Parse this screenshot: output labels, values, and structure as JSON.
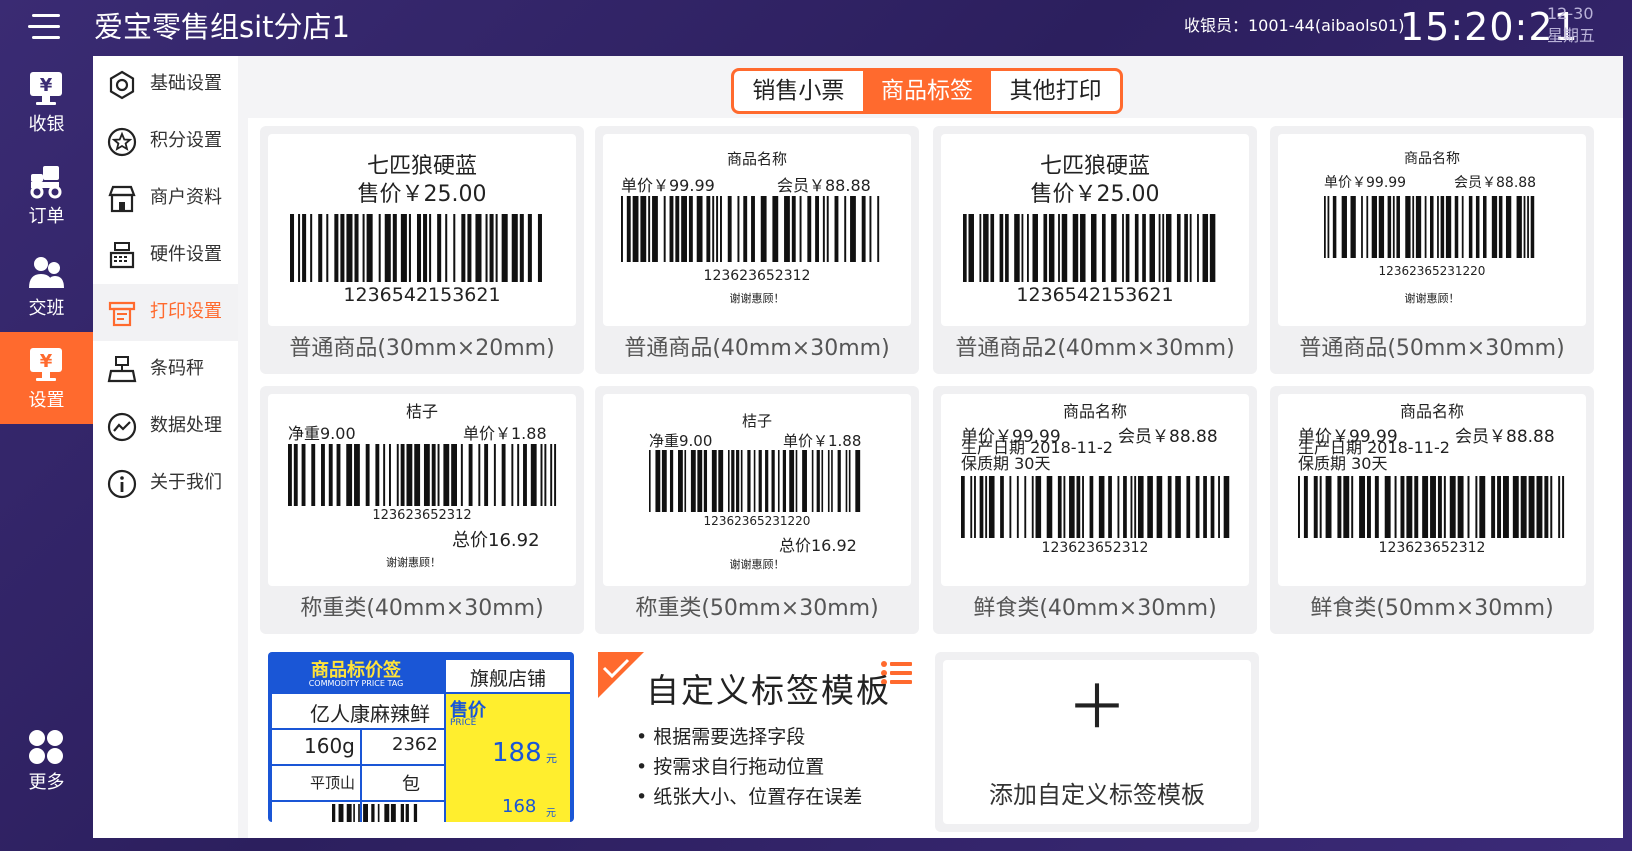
{
  "header": {
    "store_name": "爱宝零售组sit分店1",
    "cashier": "收银员：1001-44(aibaols01)",
    "time": "15:20:21",
    "date": "12-30",
    "weekday": "星期五"
  },
  "leftnav": {
    "items": [
      {
        "label": "收银",
        "icon": "cashier-icon"
      },
      {
        "label": "订单",
        "icon": "order-icon"
      },
      {
        "label": "交班",
        "icon": "shift-icon"
      },
      {
        "label": "设置",
        "icon": "settings-icon",
        "active": true
      },
      {
        "label": "更多",
        "icon": "more-icon"
      }
    ]
  },
  "submenu": {
    "items": [
      {
        "label": "基础设置"
      },
      {
        "label": "积分设置"
      },
      {
        "label": "商户资料"
      },
      {
        "label": "硬件设置"
      },
      {
        "label": "打印设置",
        "active": true
      },
      {
        "label": "条码秤"
      },
      {
        "label": "数据处理"
      },
      {
        "label": "关于我们"
      }
    ]
  },
  "tabs": [
    {
      "label": "销售小票"
    },
    {
      "label": "商品标签",
      "active": true
    },
    {
      "label": "其他打印"
    }
  ],
  "templates": {
    "t1": {
      "name": "七匹狼硬蓝",
      "price": "售价￥25.00",
      "code": "1236542153621",
      "caption": "普通商品(30mm×20mm)"
    },
    "t2": {
      "name": "商品名称",
      "unit": "单价￥99.99",
      "member": "会员￥88.88",
      "code": "123623652312",
      "thanks": "谢谢惠顾！",
      "caption": "普通商品(40mm×30mm)"
    },
    "t3": {
      "name": "七匹狼硬蓝",
      "price": "售价￥25.00",
      "code": "1236542153621",
      "caption": "普通商品2(40mm×30mm)"
    },
    "t4": {
      "name": "商品名称",
      "unit": "单价￥99.99",
      "member": "会员￥88.88",
      "code": "12362365231220",
      "thanks": "谢谢惠顾！",
      "caption": "普通商品(50mm×30mm)"
    },
    "t5": {
      "name": "桔子",
      "weight": "净重9.00",
      "unit": "单价￥1.88",
      "code": "123623652312",
      "total": "总价16.92",
      "thanks": "谢谢惠顾！",
      "caption": "称重类(40mm×30mm)"
    },
    "t6": {
      "name": "桔子",
      "weight": "净重9.00",
      "unit": "单价￥1.88",
      "code": "12362365231220",
      "total": "总价16.92",
      "thanks": "谢谢惠顾！",
      "caption": "称重类(50mm×30mm)"
    },
    "t7": {
      "name": "商品名称",
      "unit": "单价￥99.99",
      "member": "会员￥88.88",
      "prod": "生产日期 2018-11-2",
      "shelf": "保质期 30天",
      "code": "123623652312",
      "caption": "鲜食类(40mm×30mm)"
    },
    "t8": {
      "name": "商品名称",
      "unit": "单价￥99.99",
      "member": "会员￥88.88",
      "prod": "生产日期 2018-11-2",
      "shelf": "保质期 30天",
      "code": "123623652312",
      "caption": "鲜食类(50mm×30mm)"
    }
  },
  "price_tag": {
    "title": "商品标价签",
    "subtitle": "COMMODITY PRICE TAG",
    "shop": "旗舰店铺",
    "product": "亿人康麻辣鲜",
    "spec": "160g",
    "code": "2362",
    "origin": "平顶山",
    "unit": "包",
    "price_label": "售价",
    "price_en": "PRICE",
    "price": "188",
    "member_price": "168",
    "yuan": "元"
  },
  "custom": {
    "title": "自定义标签模板",
    "bullets": [
      "根据需要选择字段",
      "按需求自行拖动位置",
      "纸张大小、位置存在误差"
    ]
  },
  "add_template": {
    "plus": "＋",
    "label": "添加自定义标签模板"
  },
  "colors": {
    "accent": "#ff6a2e",
    "sidebar_bg": "#2c1f5e",
    "tag_blue": "#1a56d6",
    "tag_yellow": "#ffee2e"
  }
}
